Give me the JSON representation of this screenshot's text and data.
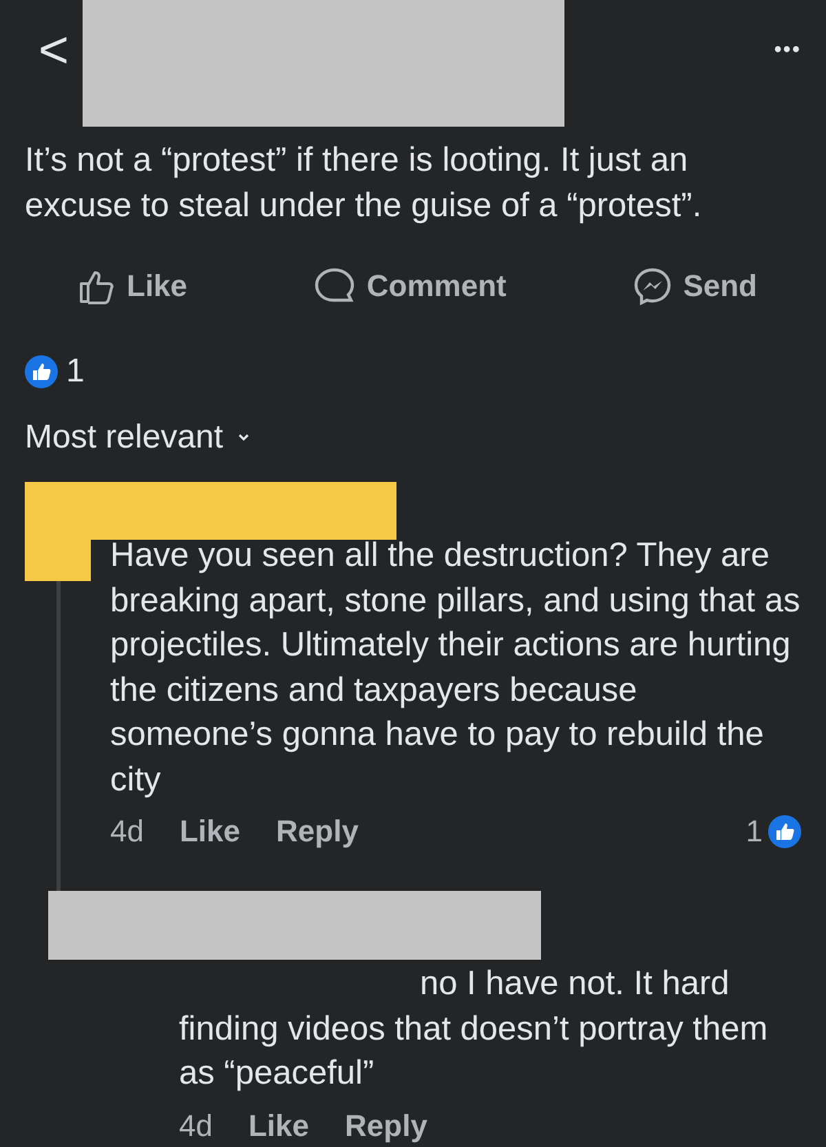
{
  "header": {
    "back": "<",
    "more": "•••"
  },
  "post": {
    "text": "It’s not a “protest” if there is looting. It just an excuse to steal under the guise of a “protest”."
  },
  "actions": [
    {
      "kind": "like",
      "label": "Like"
    },
    {
      "kind": "comment",
      "label": "Comment"
    },
    {
      "kind": "send",
      "label": "Send"
    }
  ],
  "reactions": {
    "count": "1"
  },
  "sort": {
    "label": "Most relevant"
  },
  "comments": [
    {
      "color": "#f5c946",
      "text": "Have you seen all the destruction? They are breaking apart, stone pillars, and using that as projectiles.  Ultimately their actions are hurting the citizens and taxpayers because someone’s gonna have to pay to rebuild the city",
      "time": "4d",
      "like": "Like",
      "reply": "Reply",
      "likes": "1",
      "replies": [
        {
          "color": "#c4c4c4",
          "text": "no I have not. It hard finding videos that doesn’t portray them as “peaceful”",
          "time": "4d",
          "like": "Like",
          "reply": "Reply"
        }
      ]
    }
  ]
}
